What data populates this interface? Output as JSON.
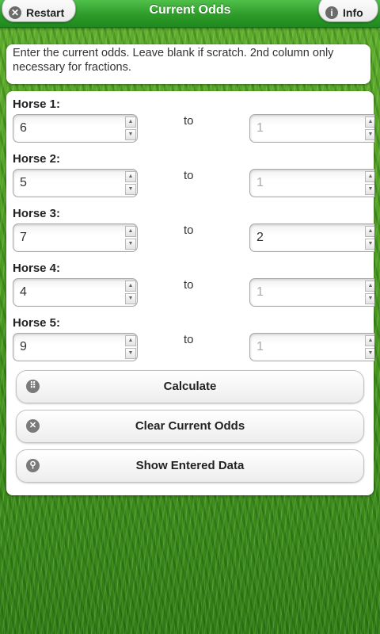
{
  "header": {
    "title": "Current Odds",
    "restart_label": "Restart",
    "info_label": "Info"
  },
  "instructions": "Enter the current odds. Leave blank if scratch. 2nd column only necessary for fractions.",
  "horses": [
    {
      "label": "Horse 1:",
      "odds": "6",
      "to_text": "to",
      "fraction": "1",
      "fraction_is_placeholder": true
    },
    {
      "label": "Horse 2:",
      "odds": "5",
      "to_text": "to",
      "fraction": "1",
      "fraction_is_placeholder": true
    },
    {
      "label": "Horse 3:",
      "odds": "7",
      "to_text": "to",
      "fraction": "2",
      "fraction_is_placeholder": false
    },
    {
      "label": "Horse 4:",
      "odds": "4",
      "to_text": "to",
      "fraction": "1",
      "fraction_is_placeholder": true
    },
    {
      "label": "Horse 5:",
      "odds": "9",
      "to_text": "to",
      "fraction": "1",
      "fraction_is_placeholder": true
    }
  ],
  "buttons": {
    "calculate": "Calculate",
    "clear": "Clear Current Odds",
    "show": "Show Entered Data"
  },
  "icons": {
    "restart": "close-circle-icon",
    "info": "info-icon",
    "calculate": "grid-icon",
    "clear": "close-circle-icon",
    "show": "search-icon"
  },
  "colors": {
    "header": "#2e9b2a",
    "panel": "#ffffff",
    "placeholder": "#aaaaaa"
  }
}
